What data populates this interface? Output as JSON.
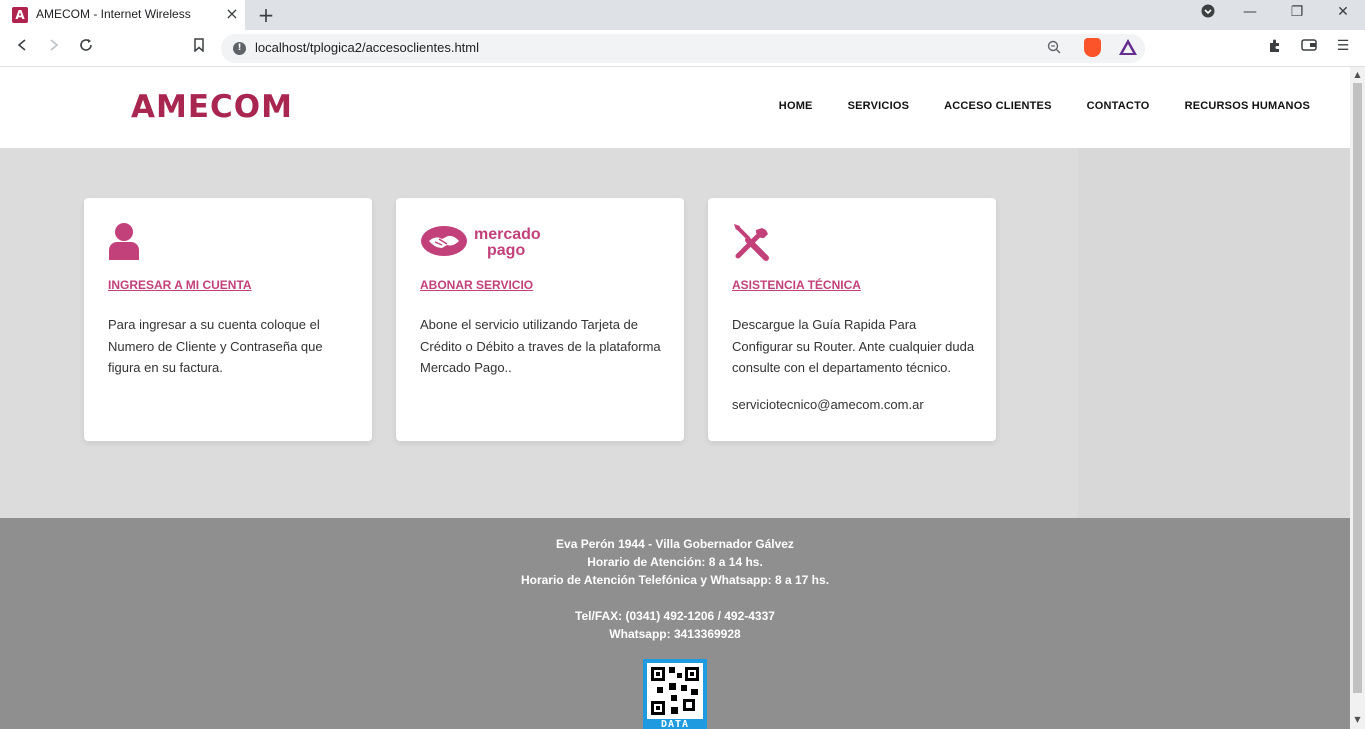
{
  "browser": {
    "tab_title": "AMECOM - Internet Wireless",
    "tab_favicon_letter": "A",
    "url": "localhost/tplogica2/accesoclientes.html"
  },
  "site": {
    "logo": "AMECOM",
    "brand_color": "#a8264f",
    "accent_color": "#c2417a",
    "menu": [
      "HOME",
      "SERVICIOS",
      "ACCESO CLIENTES",
      "CONTACTO",
      "RECURSOS HUMANOS"
    ]
  },
  "cards": [
    {
      "icon": "user-icon",
      "title": "INGRESAR A MI CUENTA",
      "text": "Para ingresar a su cuenta coloque el Numero de Cliente y Contraseña que figura en su factura.",
      "email": ""
    },
    {
      "icon": "mercado-pago-logo",
      "logo_text_1": "mercado",
      "logo_text_2": "pago",
      "title": "ABONAR SERVICIO",
      "text": "Abone el servicio utilizando Tarjeta de Crédito o Débito a traves de la plataforma Mercado Pago..",
      "email": ""
    },
    {
      "icon": "tools-icon",
      "title": "ASISTENCIA TÉCNICA",
      "text": "Descargue la Guía Rapida Para Configurar su Router. Ante cualquier duda consulte con el departamento técnico.",
      "email": "serviciotecnico@amecom.com.ar"
    }
  ],
  "footer": {
    "address": "Eva Perón 1944 - Villa Gobernador Gálvez",
    "hours": "Horario de Atención: 8 a 14 hs.",
    "phone_hours": "Horario de Atención Telefónica y Whatsapp: 8 a 17 hs.",
    "tel": "Tel/FAX: (0341) 492-1206 / 492-4337",
    "whatsapp": "Whatsapp: 3413369928",
    "qr_label": "DATA"
  }
}
